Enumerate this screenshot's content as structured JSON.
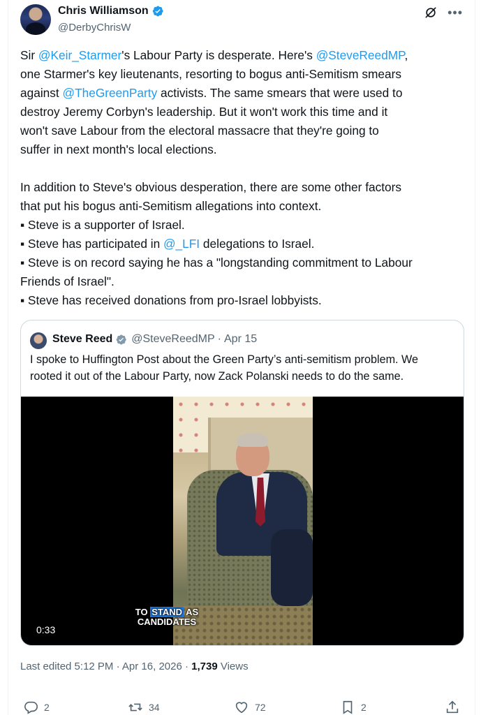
{
  "author": {
    "name": "Chris Williamson",
    "handle": "@DerbyChrisW"
  },
  "tweet": {
    "lines": [
      [
        {
          "t": "Sir "
        },
        {
          "t": "@Keir_Starmer",
          "m": true
        },
        {
          "t": "'s Labour Party is desperate. Here's "
        },
        {
          "t": "@SteveReedMP",
          "m": true
        },
        {
          "t": ","
        }
      ],
      [
        {
          "t": "one Starmer's key lieutenants, resorting to bogus anti-Semitism smears"
        }
      ],
      [
        {
          "t": "against "
        },
        {
          "t": "@TheGreenParty",
          "m": true
        },
        {
          "t": " activists. The same smears that were used to"
        }
      ],
      [
        {
          "t": "destroy Jeremy Corbyn's leadership. But it won't work this time and it"
        }
      ],
      [
        {
          "t": "won't save Labour from the electoral massacre that they're going to"
        }
      ],
      [
        {
          "t": "suffer in next month's local elections."
        }
      ],
      "gap",
      [
        {
          "t": "In addition to Steve's obvious desperation, there are some other factors"
        }
      ],
      [
        {
          "t": "that put his bogus anti-Semitism allegations into context."
        }
      ],
      [
        {
          "t": "▪ Steve is a supporter of Israel."
        }
      ],
      [
        {
          "t": "▪ Steve has participated in "
        },
        {
          "t": "@_LFI",
          "m": true
        },
        {
          "t": " delegations to Israel."
        }
      ],
      [
        {
          "t": "▪ Steve is on record saying he has a \"longstanding commitment to Labour"
        }
      ],
      [
        {
          "t": "Friends of Israel\"."
        }
      ],
      [
        {
          "t": "▪ Steve has received donations from pro-Israel lobbyists."
        }
      ]
    ]
  },
  "quoted": {
    "name": "Steve Reed",
    "handle": "@SteveReedMP",
    "separator": "·",
    "date": "Apr 15",
    "text_lines": [
      "I spoke to Huffington Post about the Green Party’s anti-semitism problem. We",
      "rooted it out of the Labour Party, now Zack Polanski needs to do the same."
    ],
    "video": {
      "caption_line1_pre": "TO ",
      "caption_line1_highlight": "STAND",
      "caption_line1_post": " AS",
      "caption_line2": "CANDIDATES",
      "duration": "0:33"
    }
  },
  "meta": {
    "edited": "Last edited 5:12 PM · Apr 16, 2026 · ",
    "views_count": "1,739",
    "views_label": " Views"
  },
  "actions": {
    "replies": "2",
    "reposts": "34",
    "likes": "72",
    "bookmarks": "2"
  },
  "colors": {
    "accent": "#1d9bf0",
    "text": "#0f1419",
    "secondary": "#536471",
    "border": "#cfd9de"
  },
  "icons": [
    "verified-badge-icon",
    "grok-icon",
    "more-icon",
    "reply-icon",
    "repost-icon",
    "like-icon",
    "bookmark-icon",
    "share-icon"
  ]
}
